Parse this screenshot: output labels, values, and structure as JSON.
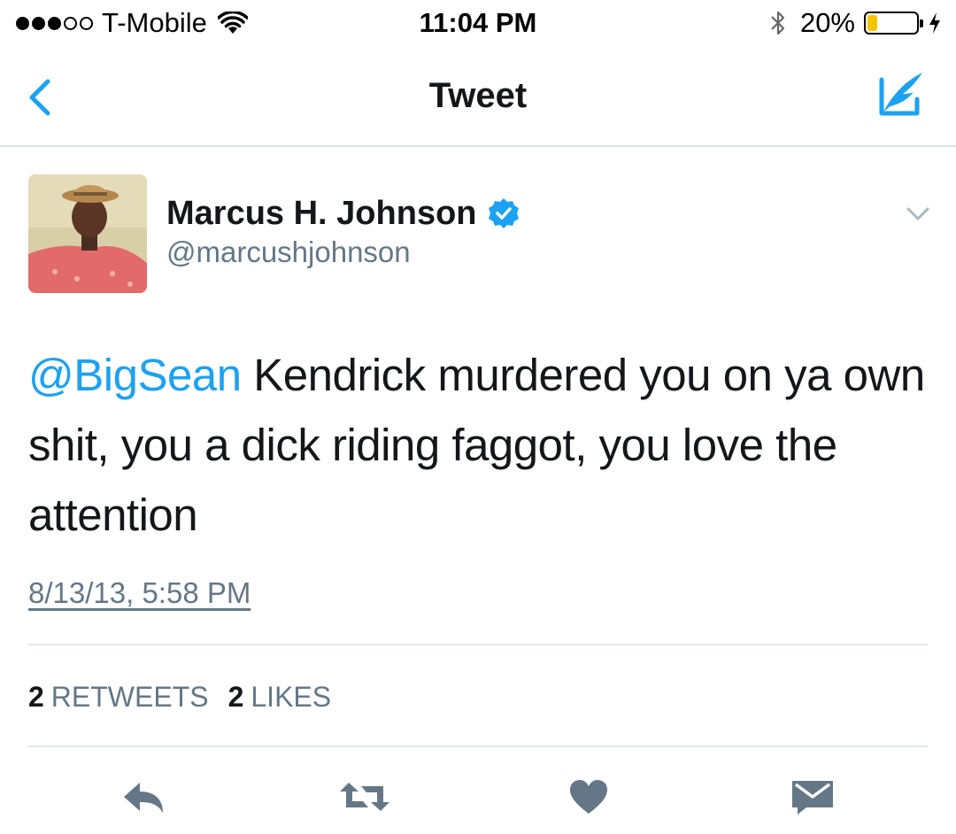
{
  "status_bar": {
    "carrier": "T-Mobile",
    "signal_bars_filled": 3,
    "signal_bars_total": 5,
    "time": "11:04 PM",
    "battery_percent": "20%",
    "battery_level": 0.2,
    "icons": [
      "wifi-icon",
      "bluetooth-icon",
      "battery-icon",
      "charging-icon"
    ]
  },
  "nav": {
    "title": "Tweet",
    "back_icon": "chevron-left-icon",
    "compose_icon": "compose-tweet-icon"
  },
  "tweet": {
    "display_name": "Marcus H. Johnson",
    "handle": "@marcushjohnson",
    "verified": true,
    "mention": "@BigSean",
    "text": " Kendrick murdered you on ya own shit, you a dick riding faggot, you love the attention",
    "timestamp": "8/13/13, 5:58 PM",
    "retweet_count": "2",
    "retweet_label": "RETWEETS",
    "like_count": "2",
    "like_label": "LIKES"
  },
  "actions": [
    "reply-icon",
    "retweet-icon",
    "like-icon",
    "direct-message-icon"
  ],
  "colors": {
    "accent": "#1da1f2",
    "text": "#14171a",
    "secondary_text": "#657786",
    "action_icon": "#657786",
    "battery_fill": "#f5c400",
    "divider": "#e1e8ed"
  }
}
